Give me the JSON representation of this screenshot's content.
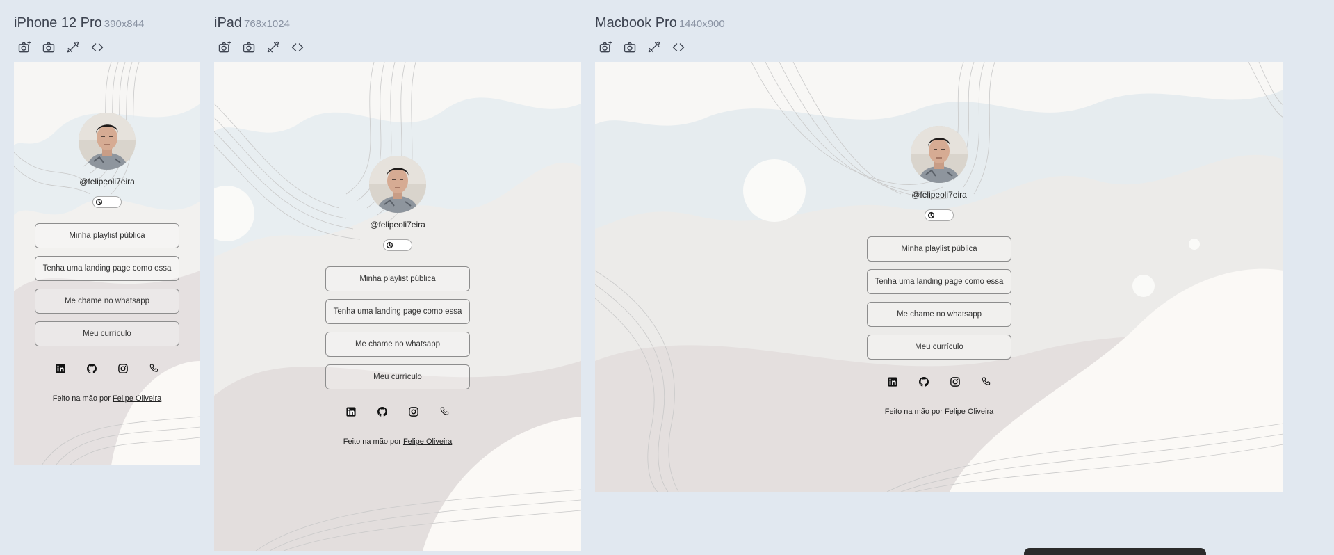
{
  "devices": [
    {
      "name": "iPhone 12 Pro",
      "dims": "390x844"
    },
    {
      "name": "iPad",
      "dims": "768x1024"
    },
    {
      "name": "Macbook Pro",
      "dims": "1440x900"
    }
  ],
  "toolbar_icons": [
    "screenshot-icon",
    "camera-icon",
    "rotate-icon",
    "code-icon"
  ],
  "profile": {
    "handle": "@felipeoli7eira",
    "links": [
      "Minha playlist pública",
      "Tenha uma landing page como essa",
      "Me chame no whatsapp",
      "Meu currículo"
    ],
    "socials": [
      "linkedin-icon",
      "github-icon",
      "instagram-icon",
      "phone-icon"
    ],
    "footer_text": "Feito na mão por",
    "footer_link": "Felipe Oliveira"
  }
}
